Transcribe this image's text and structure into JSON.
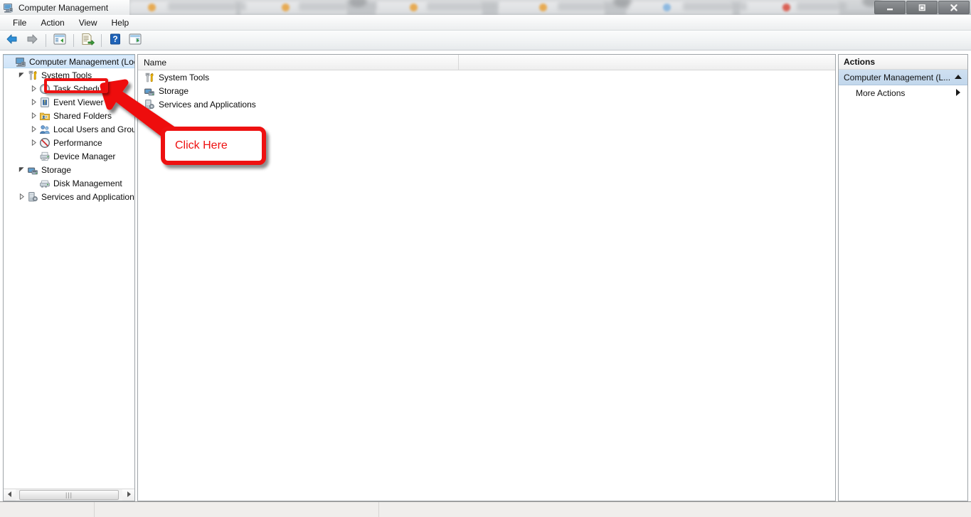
{
  "window": {
    "title": "Computer Management",
    "icon": "computer-management-icon",
    "controls": {
      "minimize": "Minimize",
      "maximize": "Maximize",
      "close": "Close"
    }
  },
  "menubar": {
    "items": [
      {
        "label": "File",
        "name": "menu-file"
      },
      {
        "label": "Action",
        "name": "menu-action"
      },
      {
        "label": "View",
        "name": "menu-view"
      },
      {
        "label": "Help",
        "name": "menu-help"
      }
    ]
  },
  "toolbar": {
    "buttons": [
      {
        "name": "back-button",
        "icon": "back-arrow-icon",
        "tooltip": "Back"
      },
      {
        "name": "forward-button",
        "icon": "forward-arrow-icon",
        "tooltip": "Forward"
      },
      {
        "name": "show-hide-tree-button",
        "icon": "console-tree-icon",
        "tooltip": "Show/Hide Console Tree"
      },
      {
        "name": "export-list-button",
        "icon": "export-list-icon",
        "tooltip": "Export List"
      },
      {
        "name": "help-button",
        "icon": "help-question-icon",
        "tooltip": "Help"
      },
      {
        "name": "show-action-pane-button",
        "icon": "action-pane-icon",
        "tooltip": "Show/Hide Action Pane"
      }
    ]
  },
  "tree": {
    "items": [
      {
        "label": "Computer Management (Local",
        "icon": "computer-icon",
        "indent": 0,
        "twisty": "none",
        "selected": true
      },
      {
        "label": "System Tools",
        "icon": "system-tools-icon",
        "indent": 1,
        "twisty": "expanded",
        "selected": false
      },
      {
        "label": "Task Scheduler",
        "icon": "clock-icon",
        "indent": 2,
        "twisty": "collapsed",
        "selected": false
      },
      {
        "label": "Event Viewer",
        "icon": "event-viewer-icon",
        "indent": 2,
        "twisty": "collapsed",
        "selected": false
      },
      {
        "label": "Shared Folders",
        "icon": "shared-folders-icon",
        "indent": 2,
        "twisty": "collapsed",
        "selected": false
      },
      {
        "label": "Local Users and Groups",
        "icon": "users-groups-icon",
        "indent": 2,
        "twisty": "collapsed",
        "selected": false
      },
      {
        "label": "Performance",
        "icon": "performance-icon",
        "indent": 2,
        "twisty": "collapsed",
        "selected": false
      },
      {
        "label": "Device Manager",
        "icon": "device-manager-icon",
        "indent": 2,
        "twisty": "none",
        "selected": false
      },
      {
        "label": "Storage",
        "icon": "storage-icon",
        "indent": 1,
        "twisty": "expanded",
        "selected": false
      },
      {
        "label": "Disk Management",
        "icon": "disk-management-icon",
        "indent": 2,
        "twisty": "none",
        "selected": false
      },
      {
        "label": "Services and Applications",
        "icon": "services-apps-icon",
        "indent": 1,
        "twisty": "collapsed",
        "selected": false
      }
    ],
    "scrollbar": {
      "name": "tree-horizontal-scrollbar",
      "grip": "|||"
    }
  },
  "main": {
    "columns": [
      {
        "label": "Name",
        "name": "column-header-name"
      },
      {
        "label": "",
        "name": "column-header-blank"
      }
    ],
    "rows": [
      {
        "label": "System Tools",
        "icon": "system-tools-icon"
      },
      {
        "label": "Storage",
        "icon": "storage-icon"
      },
      {
        "label": "Services and Applications",
        "icon": "services-apps-icon"
      }
    ]
  },
  "actions": {
    "title": "Actions",
    "group": {
      "label": "Computer Management (L...",
      "collapse_icon": "chevron-up-icon"
    },
    "items": [
      {
        "label": "More Actions",
        "submenu_icon": "chevron-right-icon"
      }
    ]
  },
  "annotation": {
    "callout_text": "Click Here",
    "highlight_target": "Task Scheduler",
    "color": "#ee1111"
  },
  "statusbar": {
    "text": ""
  }
}
